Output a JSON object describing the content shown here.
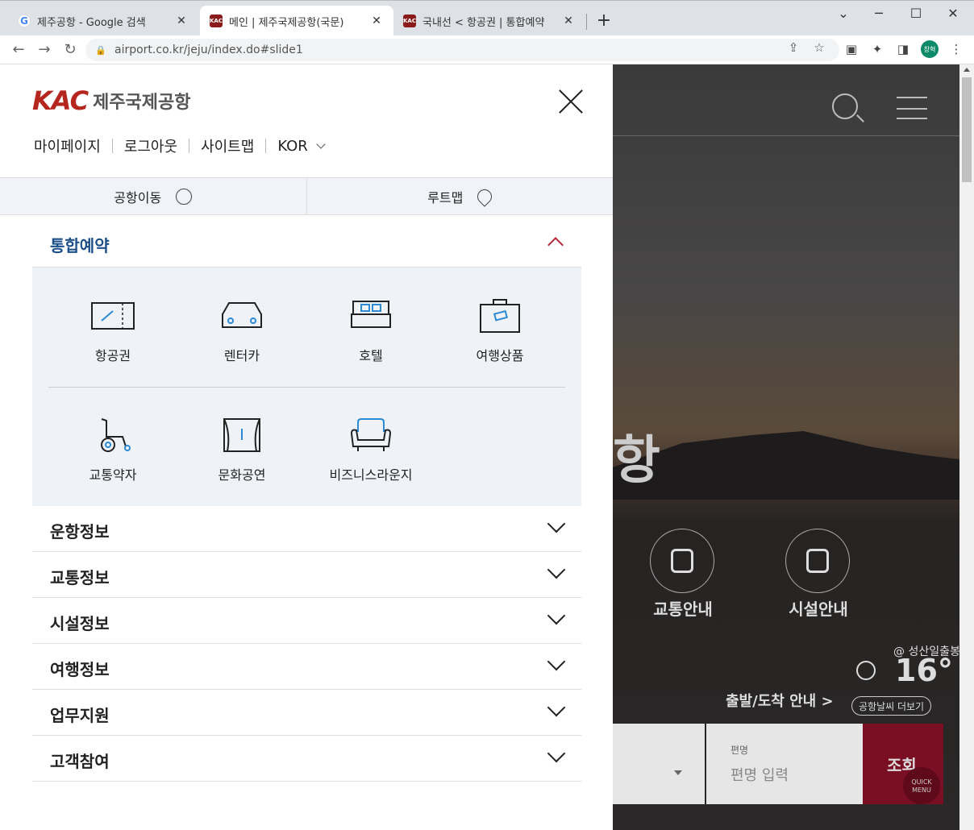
{
  "browser": {
    "tabs": [
      {
        "title": "제주공항 - Google 검색",
        "favicon": "google-icon"
      },
      {
        "title": "메인 | 제주국제공항(국문)",
        "favicon": "kac-icon"
      },
      {
        "title": "국내선 < 항공권 | 통합예약",
        "favicon": "kac-icon"
      }
    ],
    "url": "airport.co.kr/jeju/index.do#slide1",
    "profile_label": "창혁"
  },
  "menu": {
    "logo_mark": "KAC",
    "logo_name": "제주국제공항",
    "util_links": [
      "마이페이지",
      "로그아웃",
      "사이트맵",
      "KOR"
    ],
    "quick": [
      "공항이동",
      "루트맵"
    ],
    "open_section": "통합예약",
    "grid_items": [
      "항공권",
      "렌터카",
      "호텔",
      "여행상품",
      "교통약자",
      "문화공연",
      "비즈니스라운지"
    ],
    "sections": [
      "운항정보",
      "교통정보",
      "시설정보",
      "여행정보",
      "업무지원",
      "고객참여"
    ]
  },
  "background": {
    "big_char": "항",
    "circle_links": [
      "교통안내",
      "시설안내"
    ],
    "weather_location": "@ 성산일출봉",
    "weather_temp": "16°",
    "depart_link": "출발/도착 안내 >",
    "weather_more": "공항날씨 더보기",
    "flight_label": "편명",
    "flight_placeholder": "편명 입력",
    "submit_label": "조회",
    "quick_menu": "QUICK MENU"
  },
  "colors": {
    "brand_red": "#b5261e",
    "section_blue": "#1c4e8a",
    "submit": "#7a0e23"
  }
}
